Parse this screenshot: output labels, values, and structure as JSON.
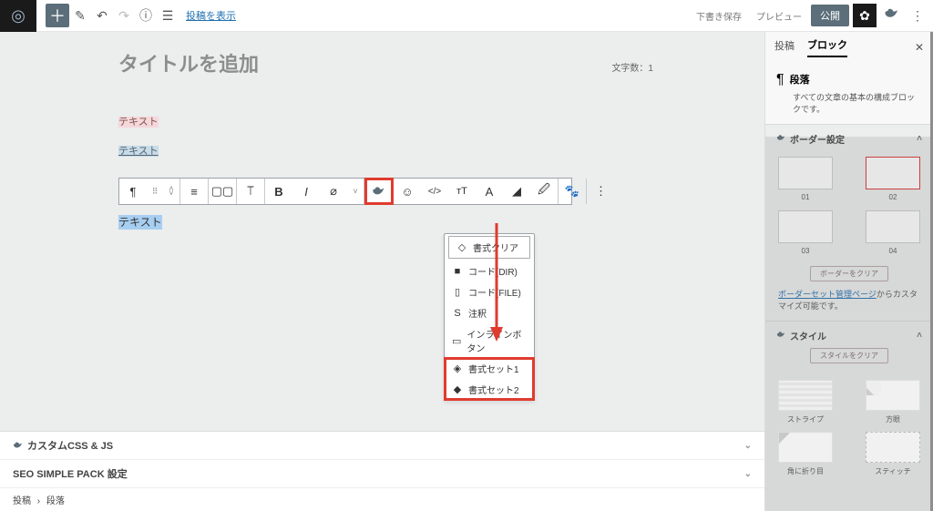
{
  "topbar": {
    "view_link": "投稿を表示",
    "save_draft": "下書き保存",
    "preview": "プレビュー",
    "publish": "公開"
  },
  "editor": {
    "title_placeholder": "タイトルを追加",
    "word_count_label": "文字数：1",
    "text1": "テキスト",
    "text2": "テキスト",
    "text3": "テキスト"
  },
  "dropdown": {
    "items": [
      {
        "icon": "eraser",
        "label": "書式クリア"
      },
      {
        "icon": "folder",
        "label": "コード(DIR)"
      },
      {
        "icon": "file",
        "label": "コード(FILE)"
      },
      {
        "icon": "s",
        "label": "注釈"
      },
      {
        "icon": "rect",
        "label": "インラインボタン"
      },
      {
        "icon": "layers",
        "label": "書式セット1"
      },
      {
        "icon": "layers",
        "label": "書式セット2"
      }
    ]
  },
  "panels": {
    "css": "カスタムCSS & JS",
    "seo": "SEO SIMPLE PACK 設定"
  },
  "breadcrumb": {
    "post": "投稿",
    "sep": "›",
    "block": "段落"
  },
  "sidebar": {
    "tabs": {
      "post": "投稿",
      "block": "ブロック"
    },
    "block": {
      "name": "段落",
      "desc": "すべての文章の基本の構成ブロックです。"
    },
    "border": {
      "title": "ボーダー設定",
      "nums": [
        "01",
        "02",
        "03",
        "04"
      ],
      "clear": "ボーダーをクリア",
      "link": "ボーダーセット管理ページ",
      "link_after": "からカスタマイズ可能です。"
    },
    "style": {
      "title": "スタイル",
      "clear": "スタイルをクリア",
      "labels": [
        "ストライプ",
        "方眼",
        "角に折り目",
        "スティッチ"
      ]
    }
  }
}
